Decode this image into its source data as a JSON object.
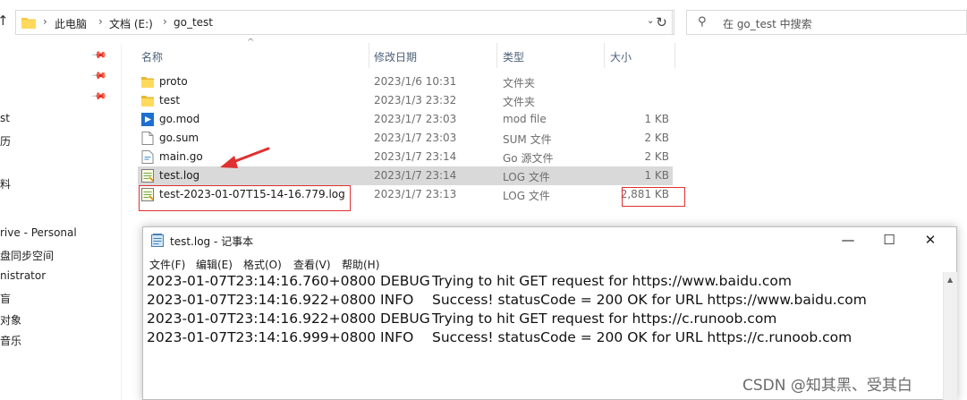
{
  "explorer": {
    "breadcrumbs": [
      "此电脑",
      "文档 (E:)",
      "go_test"
    ],
    "search_placeholder": "在 go_test 中搜索",
    "left_pane_items": [
      "st",
      "历",
      "料",
      "rive - Personal",
      "盘同步空间",
      "nistrator",
      "盲",
      "对象",
      "音乐"
    ],
    "columns": {
      "name": "名称",
      "date": "修改日期",
      "type": "类型",
      "size": "大小"
    },
    "files": [
      {
        "name": "proto",
        "date": "2023/1/6 10:31",
        "type": "文件夹",
        "size": "",
        "icon": "folder-icon"
      },
      {
        "name": "test",
        "date": "2023/1/3 23:32",
        "type": "文件夹",
        "size": "",
        "icon": "folder-icon"
      },
      {
        "name": "go.mod",
        "date": "2023/1/7 23:03",
        "type": "mod file",
        "size": "1 KB",
        "icon": "mod-file-icon"
      },
      {
        "name": "go.sum",
        "date": "2023/1/7 23:03",
        "type": "SUM 文件",
        "size": "2 KB",
        "icon": "file-icon"
      },
      {
        "name": "main.go",
        "date": "2023/1/7 23:14",
        "type": "Go 源文件",
        "size": "2 KB",
        "icon": "go-file-icon"
      },
      {
        "name": "test.log",
        "date": "2023/1/7 23:14",
        "type": "LOG 文件",
        "size": "1 KB",
        "icon": "log-file-icon",
        "selected": true
      },
      {
        "name": "test-2023-01-07T15-14-16.779.log",
        "date": "2023/1/7 23:13",
        "type": "LOG 文件",
        "size": "2,881 KB",
        "icon": "log-file-icon"
      }
    ]
  },
  "notepad": {
    "title": "test.log - 记事本",
    "menu": [
      "文件(F)",
      "编辑(E)",
      "格式(O)",
      "查看(V)",
      "帮助(H)"
    ],
    "lines": [
      {
        "ts": "2023-01-07T23:14:16.760+0800",
        "level": "DEBUG",
        "msg": "Trying to hit GET request for https://www.baidu.com"
      },
      {
        "ts": "2023-01-07T23:14:16.922+0800",
        "level": "INFO",
        "msg": "Success! statusCode = 200 OK for URL https://www.baidu.com"
      },
      {
        "ts": "2023-01-07T23:14:16.922+0800",
        "level": "DEBUG",
        "msg": "Trying to hit GET request for https://c.runoob.com"
      },
      {
        "ts": "2023-01-07T23:14:16.999+0800",
        "level": "INFO",
        "msg": "Success! statusCode = 200 OK for URL https://c.runoob.com"
      }
    ]
  },
  "watermark": "CSDN @知其黑、受其白",
  "colors": {
    "annotation_red": "#e03030",
    "selected_row": "#d9d9d9",
    "folder_yellow": "#f5c842"
  }
}
